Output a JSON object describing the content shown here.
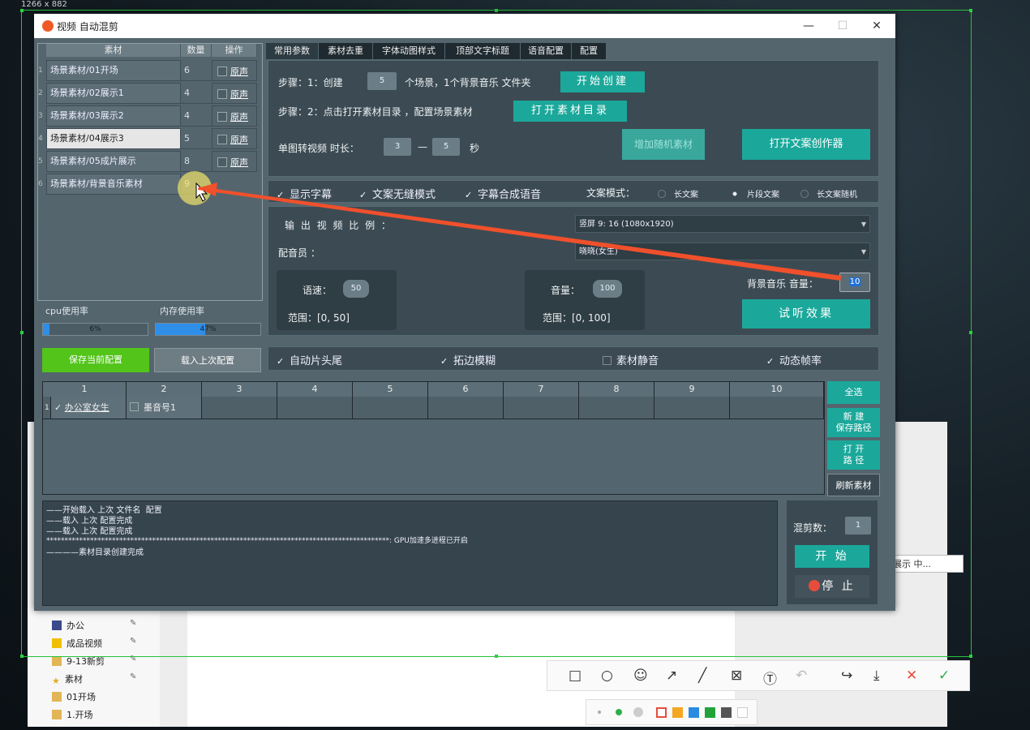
{
  "screen_size_label": "1266 x 882",
  "app": {
    "title": "视频 自动混剪"
  },
  "materials": {
    "headers": [
      "素材",
      "数量",
      "操作"
    ],
    "rows": [
      {
        "idx": "1",
        "name": "场景素材/01开场",
        "count": "6",
        "op": "原声"
      },
      {
        "idx": "2",
        "name": "场景素材/02展示1",
        "count": "4",
        "op": "原声"
      },
      {
        "idx": "3",
        "name": "场景素材/03展示2",
        "count": "4",
        "op": "原声"
      },
      {
        "idx": "4",
        "name": "场景素材/04展示3",
        "count": "5",
        "op": "原声"
      },
      {
        "idx": "5",
        "name": "场景素材/05成片展示",
        "count": "8",
        "op": "原声"
      },
      {
        "idx": "6",
        "name": "场景素材/背景音乐素材",
        "count": "9",
        "op": ""
      }
    ]
  },
  "usage": {
    "cpu_label": "cpu使用率",
    "cpu_value": "6%",
    "cpu_fraction": 0.06,
    "mem_label": "内存使用率",
    "mem_value": "47%",
    "mem_fraction": 0.47
  },
  "buttons": {
    "save_config": "保存当前配置",
    "load_config": "载入上次配置"
  },
  "tabs": [
    "常用参数",
    "素材去重",
    "字体动图样式",
    "顶部文字标题",
    "语音配置",
    "配置"
  ],
  "step1": {
    "prefix": "步骤：1：创建",
    "count": "5",
    "suffix": "个场景，1个背景音乐 文件夹",
    "button": "开始创建"
  },
  "step2": {
    "text": "步骤：2：点击打开素材目录 ，配置场景素材",
    "button": "打开素材目录"
  },
  "single": {
    "label": "单图转视频 时长：",
    "min": "3",
    "dash": "—",
    "max": "5",
    "unit": "秒",
    "button_blur": "增加随机素材",
    "button_copy": "打开文案创作器"
  },
  "options": {
    "show_subtitle": "显示字幕",
    "seamless": "文案无缝模式",
    "tts": "字幕合成语音",
    "mode_label": "文案模式：",
    "modes": [
      "长文案",
      "片段文案",
      "长文案随机"
    ],
    "mode_selected": 1
  },
  "output": {
    "ratio_label": "输 出 视 频 比 例 ：",
    "ratio_value": "竖屏 9: 16 (1080x1920)",
    "voice_label": "配音员 ：",
    "voice_value": "晓晓(女生)"
  },
  "speech": {
    "speed_label": "语速：",
    "speed_value": "50",
    "speed_range": "范围：[0, 50]",
    "vol_label": "音量：",
    "vol_value": "100",
    "vol_range": "范围：[0, 100]",
    "bgm_label": "背景音乐 音量：",
    "bgm_value": "10",
    "preview_button": "试听效果"
  },
  "bottom_opts": {
    "auto_headtail": "自动片头尾",
    "blur_edge": "拓边模糊",
    "mute": "素材静音",
    "dyn_fps": "动态帧率"
  },
  "grid": {
    "headers": [
      "1",
      "2",
      "3",
      "4",
      "5",
      "6",
      "7",
      "8",
      "9",
      "10"
    ],
    "row_index": "1",
    "cells": [
      "办公室女生",
      "墨音号1"
    ]
  },
  "side_buttons": {
    "select_all": "全选",
    "new_save_line1": "新 建",
    "new_save_line2": "保存路径",
    "open_line1": "打 开",
    "open_line2": "路 径",
    "refresh": "刷新素材"
  },
  "log_lines": [
    "——开始载入 上次 文件名  配置",
    "——载入 上次 配置完成",
    "——载入 上次 配置完成",
    "**********************************************************************************************: GPU加速多进程已开启",
    "————素材目录创建完成"
  ],
  "control": {
    "mix_label": "混剪数：",
    "mix_value": "1",
    "start": "开 始",
    "stop": "停 止"
  },
  "explorer": {
    "items": [
      {
        "name": "办公",
        "icon": "doc-icon"
      },
      {
        "name": "成品视频",
        "icon": "warning-icon"
      },
      {
        "name": "9-13新剪",
        "icon": "folder-icon"
      },
      {
        "name": "素材",
        "icon": "star-icon"
      },
      {
        "name": "01开场",
        "icon": "folder-icon"
      },
      {
        "name": "1.开场",
        "icon": "folder-icon"
      }
    ],
    "right_field": "展示 中..."
  },
  "colors": {
    "accent_teal": "#1ba89b",
    "green_button": "#52c41a",
    "stop_red": "#e74c3c"
  }
}
